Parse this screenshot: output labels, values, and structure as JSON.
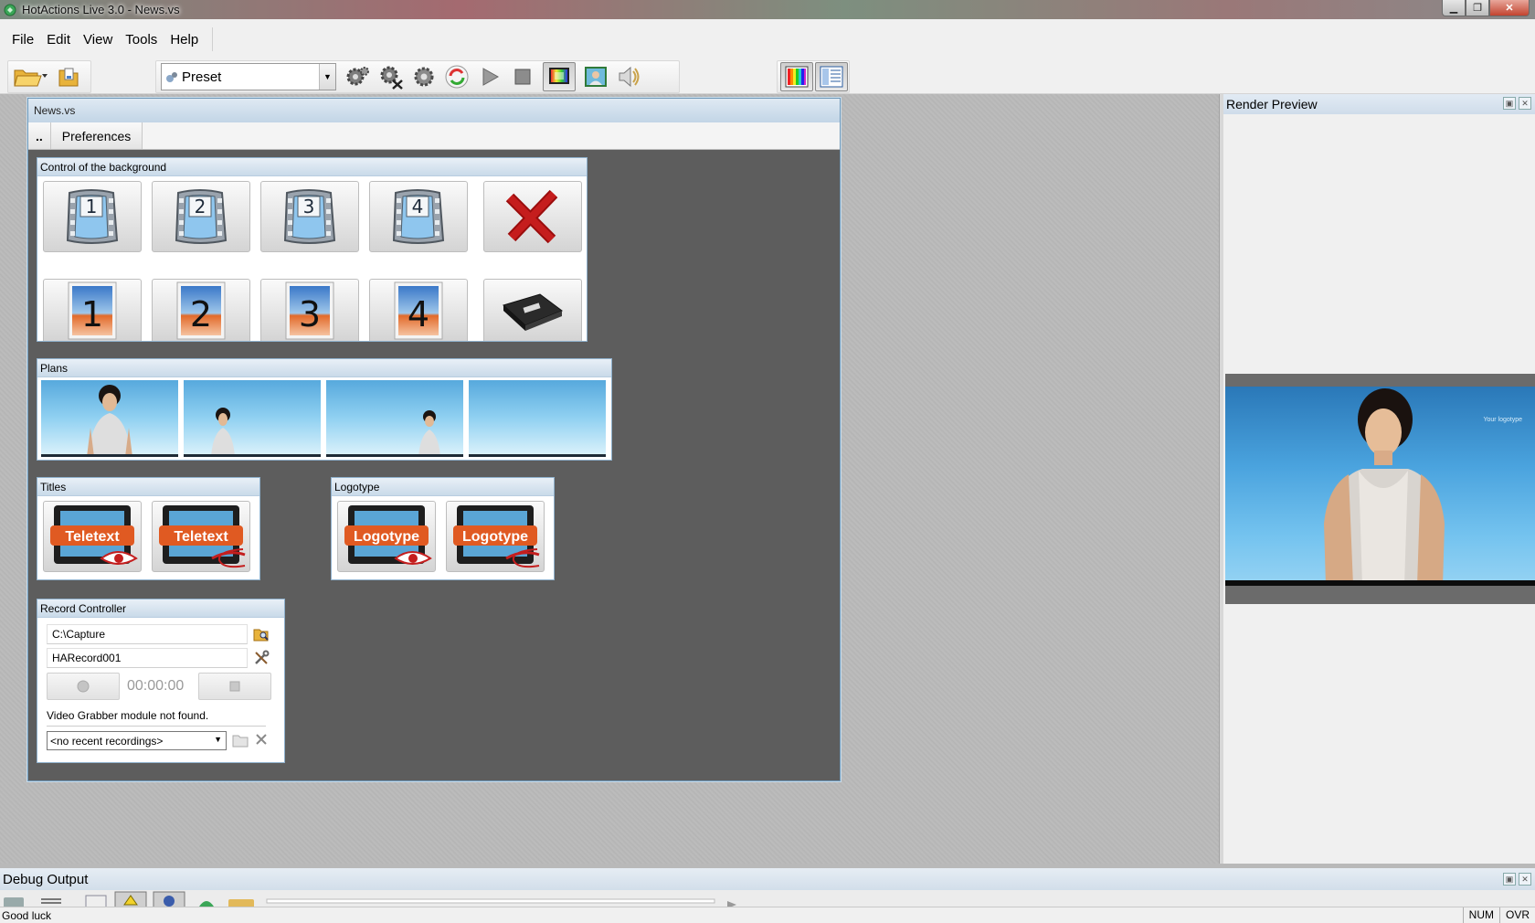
{
  "window": {
    "title": "HotActions Live 3.0 - News.vs"
  },
  "menu": [
    "File",
    "Edit",
    "View",
    "Tools",
    "Help"
  ],
  "toolbar": {
    "preset": "Preset"
  },
  "document": {
    "title": "News.vs",
    "tabs": {
      "up": "..",
      "preferences": "Preferences"
    },
    "background": {
      "title": "Control of the background",
      "video_buttons": [
        "1",
        "2",
        "3",
        "4"
      ],
      "image_buttons": [
        "1",
        "2",
        "3",
        "4"
      ]
    },
    "plans": {
      "title": "Plans"
    },
    "titles": {
      "title": "Titles",
      "button_label": "Teletext"
    },
    "logotype": {
      "title": "Logotype",
      "button_label": "Logotype"
    },
    "record": {
      "title": "Record Controller",
      "path": "C:\\Capture",
      "filename": "HARecord001",
      "timer": "00:00:00",
      "message": "Video Grabber module not found.",
      "recent": "<no recent recordings>"
    }
  },
  "render_preview": {
    "title": "Render Preview",
    "logo_text": "Your logotype"
  },
  "debug": {
    "title": "Debug Output"
  },
  "status": {
    "text": "Good luck",
    "num": "NUM",
    "ovr": "OVR"
  }
}
